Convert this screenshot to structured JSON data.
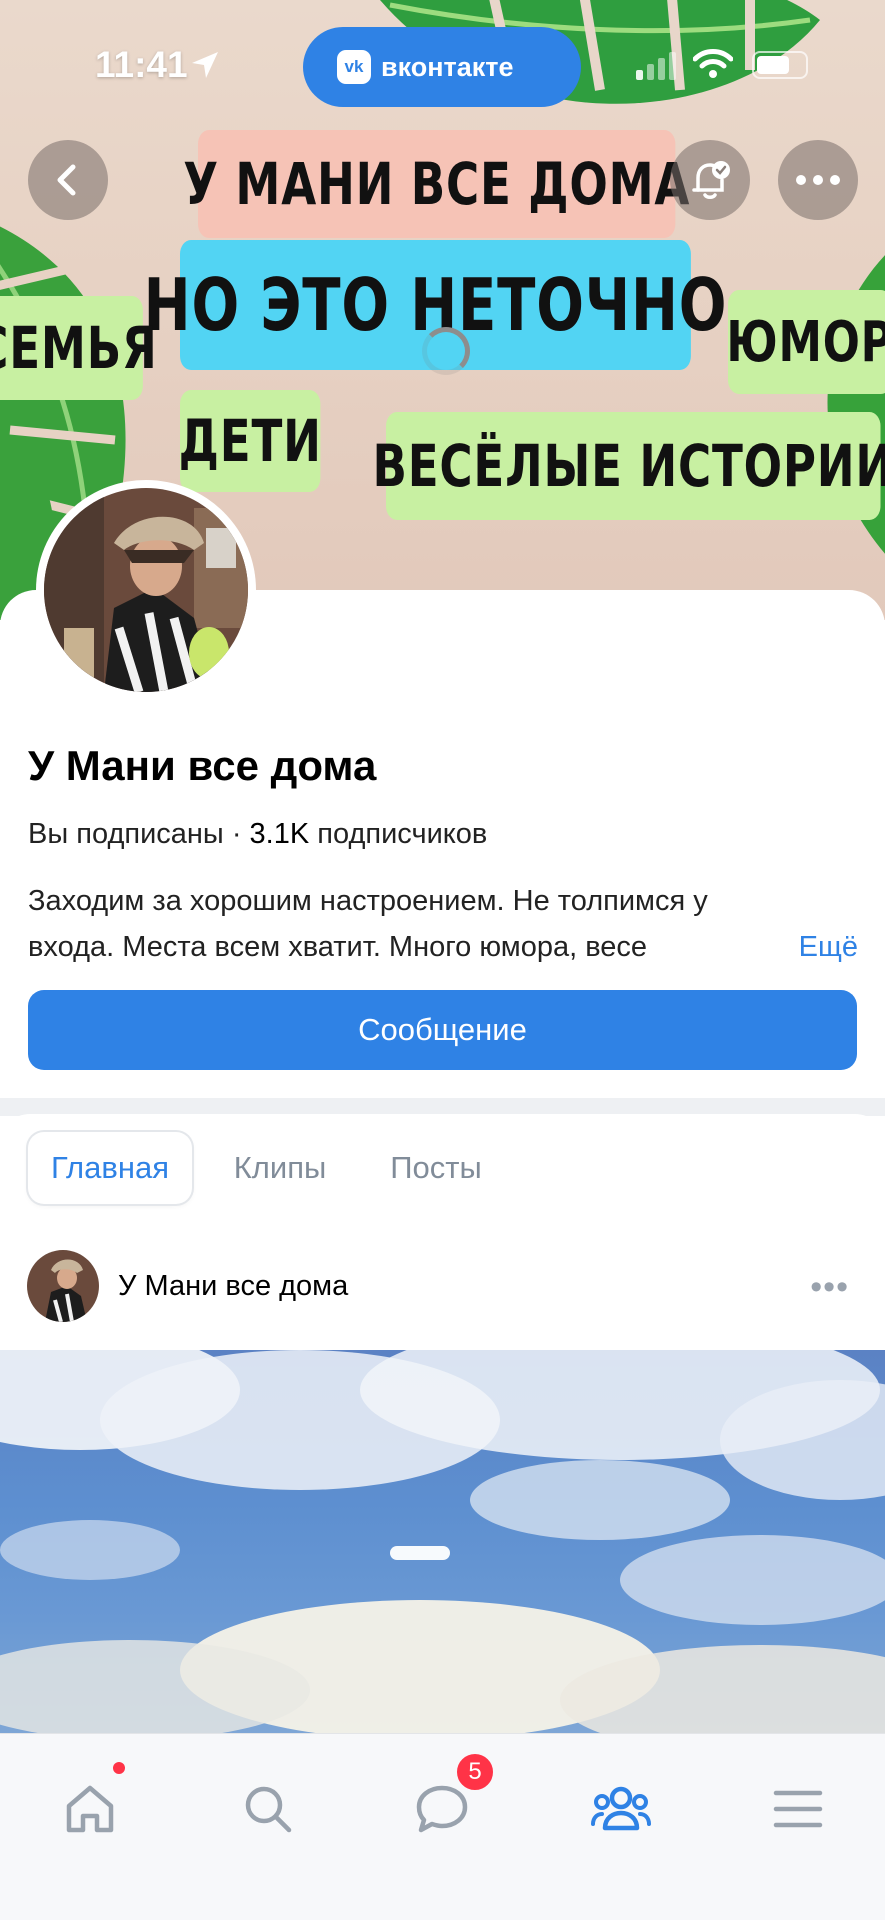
{
  "status_bar": {
    "time": "11:41",
    "app_pill_logo": "vk",
    "app_pill_label": "вконтакте",
    "icons": [
      "location-arrow-icon",
      "signal-icon",
      "wifi-icon",
      "battery-icon"
    ]
  },
  "cover": {
    "tags": [
      "У МАНИ ВСЕ ДОМА",
      "НО ЭТО НЕТОЧНО",
      "СЕМЬЯ",
      "ЮМОР",
      "ДЕТИ",
      "ВЕСЁЛЫЕ ИСТОРИИ"
    ]
  },
  "header_actions": {
    "back_icon": "chevron-left-icon",
    "notify_icon": "bell-check-icon",
    "more_icon": "more-horizontal-icon"
  },
  "profile": {
    "name": "У Мани все дома",
    "subscribed": "Вы подписаны",
    "separator": "·",
    "subscribers": "3.1K",
    "subscribers_label": "подписчиков",
    "description_line1": "Заходим за хорошим настроением. Не толпимся у",
    "description_line2": "входа. Места всем хватит. Много юмора, весе",
    "more_link": "Ещё",
    "message_button": "Сообщение"
  },
  "tabs": [
    {
      "label": "Главная",
      "active": true
    },
    {
      "label": "Клипы",
      "active": false
    },
    {
      "label": "Посты",
      "active": false
    }
  ],
  "post": {
    "author": "У Мани все дома",
    "more": "•••"
  },
  "bottom_nav": {
    "items": [
      {
        "icon": "home-icon",
        "active": false,
        "has_dot": true
      },
      {
        "icon": "search-icon",
        "active": false
      },
      {
        "icon": "messages-icon",
        "active": false,
        "badge": "5"
      },
      {
        "icon": "community-icon",
        "active": true
      },
      {
        "icon": "menu-icon",
        "active": false
      }
    ]
  },
  "colors": {
    "accent": "#2F82E5",
    "badge": "#FF3347",
    "inactive": "#818C99"
  }
}
